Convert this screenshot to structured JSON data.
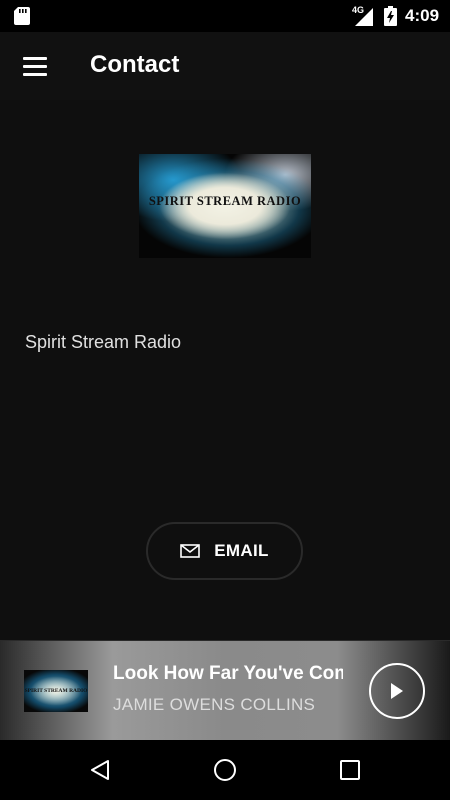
{
  "status_bar": {
    "network": "4G",
    "time": "4:09"
  },
  "app_bar": {
    "title": "Contact"
  },
  "logo": {
    "text": "SPIRIT STREAM RADIO"
  },
  "station": {
    "name": "Spirit Stream Radio"
  },
  "email_button": {
    "label": "EMAIL"
  },
  "player": {
    "art_text": "SPIRIT STREAM RADIO",
    "track_title": "Look How Far You've Com",
    "artist": "JAMIE OWENS COLLINS"
  },
  "icons": {
    "status": [
      "sd-card-icon",
      "signal-icon",
      "battery-icon"
    ],
    "app_bar": [
      "menu-icon"
    ],
    "email": "mail-icon",
    "player": "play-icon",
    "nav": [
      "back-icon",
      "home-icon",
      "recents-icon"
    ]
  },
  "colors": {
    "background": "#0f0f0f",
    "status_bar": "#000000",
    "text_primary": "#ffffff",
    "text_secondary": "#e0e0e0"
  }
}
